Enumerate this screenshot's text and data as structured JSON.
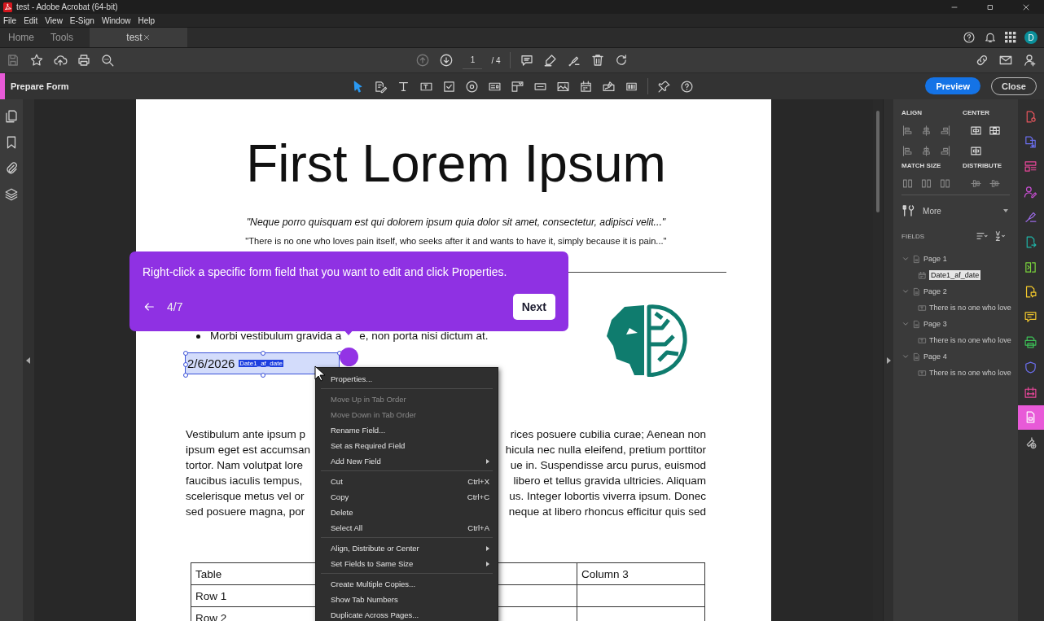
{
  "window": {
    "title": "test - Adobe Acrobat (64-bit)"
  },
  "menu_bar": [
    "File",
    "Edit",
    "View",
    "E-Sign",
    "Window",
    "Help"
  ],
  "tabs": [
    {
      "label": "Home",
      "selected": false
    },
    {
      "label": "Tools",
      "selected": false
    },
    {
      "label": "test",
      "selected": true
    }
  ],
  "account": {
    "initial": "D"
  },
  "page_nav": {
    "current": "1",
    "total": "/ 4"
  },
  "prepare_form": {
    "title": "Prepare Form",
    "preview": "Preview",
    "close": "Close",
    "tools": [
      {
        "kind": "pointer",
        "selected": true
      },
      {
        "kind": "edit",
        "selected": false
      },
      {
        "kind": "text",
        "selected": false
      },
      {
        "kind": "textfield",
        "selected": false
      },
      {
        "kind": "checkbox",
        "selected": false
      },
      {
        "kind": "radio",
        "selected": false
      },
      {
        "kind": "listbox",
        "selected": false
      },
      {
        "kind": "dropdown",
        "selected": false
      },
      {
        "kind": "okbutton",
        "selected": false
      },
      {
        "kind": "image",
        "selected": false
      },
      {
        "kind": "date",
        "selected": false
      },
      {
        "kind": "signature",
        "selected": false
      },
      {
        "kind": "barcode",
        "selected": false
      }
    ]
  },
  "document": {
    "title": "First Lorem Ipsum",
    "quote": "\"Neque porro quisquam est qui dolorem ipsum quia dolor sit amet, consectetur, adipisci velit...\"",
    "subquote": "\"There is no one who loves pain itself, who seeks after it and wants to have it, simply because it is pain...\"",
    "bullet": {
      "left": "Morbi vestibulum gravida a",
      "right": "e, non porta nisi dictum at."
    },
    "date_field": {
      "value": "2/6/2026",
      "name": "Date1_af_date",
      "selected": true
    },
    "paragraph_lines": [
      {
        "left": "Vestibulum ante ipsum p",
        "right": "rices posuere cubilia curae; Aenean non"
      },
      {
        "left": "ipsum eget est accumsan",
        "right": "hicula nec nulla eleifend, pretium porttitor"
      },
      {
        "left": "tortor. Nam volutpat lore",
        "right": "ue in. Suspendisse arcu purus, euismod"
      },
      {
        "left": "faucibus iaculis tempus,",
        "right": "libero et tellus gravida ultricies. Aliquam"
      },
      {
        "left": "scelerisque metus vel or",
        "right": "us. Integer lobortis viverra ipsum. Donec"
      },
      {
        "left": "sed posuere magna, por",
        "right": "neque at libero rhoncus efficitur quis sed"
      }
    ],
    "table": {
      "header": {
        "column_1": "Table",
        "column_3": "Column 3"
      },
      "rows": [
        {
          "column_1": "Row 1"
        },
        {
          "column_1": "Row 2"
        }
      ]
    }
  },
  "tooltip": {
    "text": "Right-click a specific form field that you want to edit and click Properties.",
    "step": "4/7",
    "next": "Next"
  },
  "context_menu": [
    {
      "kind": "item",
      "label": "Properties...",
      "disabled": false
    },
    {
      "kind": "separator"
    },
    {
      "kind": "item",
      "label": "Move Up in Tab Order",
      "disabled": true
    },
    {
      "kind": "item",
      "label": "Move Down in Tab Order",
      "disabled": true
    },
    {
      "kind": "item",
      "label": "Rename Field...",
      "disabled": false
    },
    {
      "kind": "item",
      "label": "Set as Required Field",
      "disabled": false
    },
    {
      "kind": "item",
      "label": "Add New Field",
      "disabled": false,
      "submenu": true
    },
    {
      "kind": "separator"
    },
    {
      "kind": "item",
      "label": "Cut",
      "shortcut": "Ctrl+X",
      "disabled": false
    },
    {
      "kind": "item",
      "label": "Copy",
      "shortcut": "Ctrl+C",
      "disabled": false
    },
    {
      "kind": "item",
      "label": "Delete",
      "disabled": false
    },
    {
      "kind": "item",
      "label": "Select All",
      "shortcut": "Ctrl+A",
      "disabled": false
    },
    {
      "kind": "separator"
    },
    {
      "kind": "item",
      "label": "Align, Distribute or Center",
      "disabled": false,
      "submenu": true
    },
    {
      "kind": "item",
      "label": "Set Fields to Same Size",
      "disabled": false,
      "submenu": true
    },
    {
      "kind": "separator"
    },
    {
      "kind": "item",
      "label": "Create Multiple Copies...",
      "disabled": false
    },
    {
      "kind": "item",
      "label": "Show Tab Numbers",
      "disabled": false
    },
    {
      "kind": "item",
      "label": "Duplicate Across Pages...",
      "disabled": false
    }
  ],
  "right_panel": {
    "align": "ALIGN",
    "center": "CENTER",
    "match_size": "MATCH SIZE",
    "distribute": "DISTRIBUTE",
    "more": "More",
    "fields": "FIELDS",
    "tree": [
      {
        "label": "Page 1",
        "expanded": true,
        "selected": false,
        "children": [
          {
            "label": "Date1_af_date",
            "kind": "date",
            "selected": true
          }
        ]
      },
      {
        "label": "Page 2",
        "expanded": true,
        "selected": false,
        "children": [
          {
            "label": "There is no one who love",
            "kind": "text",
            "selected": false
          }
        ]
      },
      {
        "label": "Page 3",
        "expanded": true,
        "selected": false,
        "children": [
          {
            "label": "There is no one who love",
            "kind": "text",
            "selected": false
          }
        ]
      },
      {
        "label": "Page 4",
        "expanded": true,
        "selected": false,
        "children": [
          {
            "label": "There is no one who love",
            "kind": "text",
            "selected": false
          }
        ]
      }
    ]
  },
  "right_tools": [
    {
      "selected": false
    },
    {
      "selected": false
    },
    {
      "selected": false
    },
    {
      "selected": false
    },
    {
      "selected": false
    },
    {
      "selected": false
    },
    {
      "selected": false
    },
    {
      "selected": false
    },
    {
      "selected": false
    },
    {
      "selected": false
    },
    {
      "selected": false
    },
    {
      "selected": false
    },
    {
      "selected": true
    },
    {
      "selected": false
    }
  ]
}
